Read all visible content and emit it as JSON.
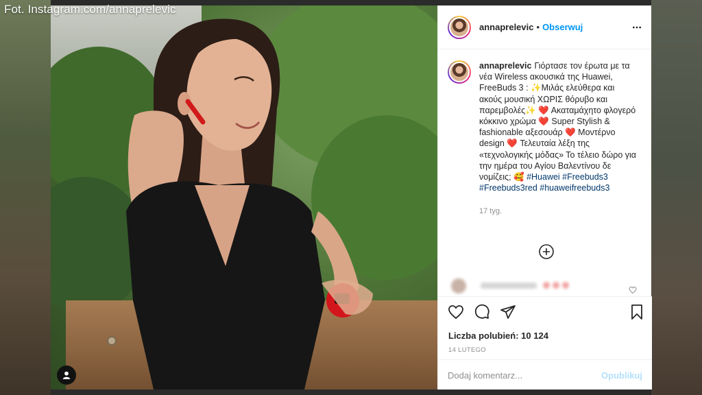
{
  "credit": "Fot. Instagram.com/annaprelevic",
  "post": {
    "username": "annaprelevic",
    "follow_label": "Obserwuj",
    "header_separator": "•",
    "caption": "Γιόρτασε τον έρωτα με τα νέα Wireless ακουσικά της Huawei, FreeBuds 3 : ✨Μιλάς ελεύθερα και ακούς μουσική ΧΩΡΙΣ θόρυβο και παρεμβολές✨ ❤️ Ακαταμάχητο φλογερό κόκκινο χρώμα ❤️ Super Stylish & fashionable αξεσουάρ ❤️ Μοντέρνο design ❤️ Τελευταία λέξη της «τεχνολογικής μόδας» Το τέλειο δώρο για την ημέρα του Αγίου Βαλεντίνου δε νομίζεις; 🥰",
    "hashtags": "#Huawei #Freebuds3 #Freebuds3red #huaweifreebuds3",
    "age": "17 tyg.",
    "likes_label": "Liczba polubień: 10 124",
    "date": "14 LUTEGO",
    "comment_placeholder": "Dodaj komentarz...",
    "publish_label": "Opublikuj"
  },
  "colors": {
    "accent_blue": "#0095f6",
    "hashtag_blue": "#00376b",
    "publish_disabled": "#b2dffc",
    "heart_red": "#ed4956"
  },
  "icons": {
    "header": "more-horizontal-icon",
    "load_more": "plus-circle-icon",
    "actions": [
      "heart-icon",
      "comment-icon",
      "share-icon",
      "bookmark-icon"
    ],
    "photo": "user-tag-icon"
  }
}
